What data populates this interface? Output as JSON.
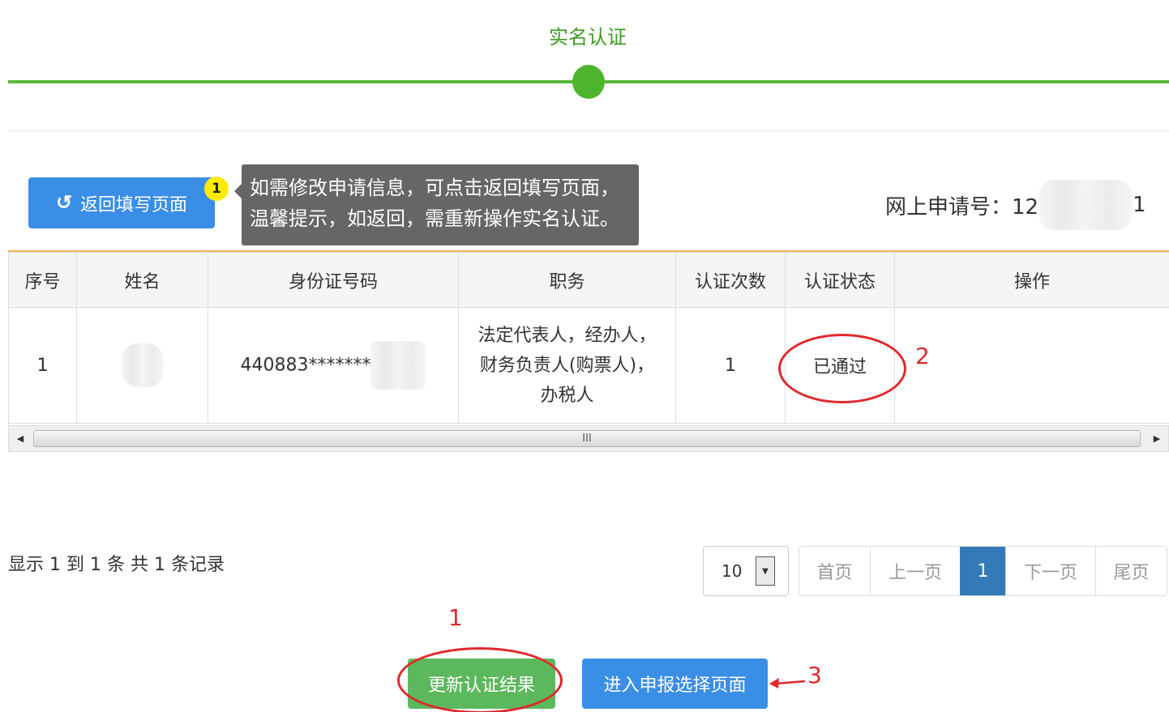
{
  "step": {
    "title": "实名认证"
  },
  "toolbar": {
    "back_label": "返回填写页面",
    "back_icon": "refresh-icon",
    "badge_number": "1"
  },
  "tooltip": {
    "line1": "如需修改申请信息，可点击返回填写页面，",
    "line2": "温馨提示，如返回，需重新操作实名认证。"
  },
  "application": {
    "label": "网上申请号：12",
    "suffix": "1"
  },
  "table": {
    "columns": [
      "序号",
      "姓名",
      "身份证号码",
      "职务",
      "认证次数",
      "认证状态",
      "操作"
    ],
    "rows": [
      {
        "index": "1",
        "name": "",
        "id_number": "440883*******",
        "duty_line1": "法定代表人，经办人，",
        "duty_line2": "财务负责人(购票人)，",
        "duty_line3": "办税人",
        "count": "1",
        "status": "已通过",
        "action": ""
      }
    ]
  },
  "scrollbar": {
    "thumb_grip": "III"
  },
  "pagination": {
    "record_info": "显示 1 到 1 条 共 1 条记录",
    "page_size": "10",
    "first": "首页",
    "prev": "上一页",
    "current": "1",
    "next": "下一页",
    "last": "尾页"
  },
  "actions": {
    "refresh_label": "更新认证结果",
    "enter_label": "进入申报选择页面"
  },
  "annotations": {
    "status_mark": "2",
    "refresh_mark": "1",
    "enter_mark": "3"
  },
  "colors": {
    "accent_green": "#5cb85c",
    "primary_blue": "#3a8ee6",
    "annotation_red": "#e0282c",
    "step_green": "#4cb52c"
  }
}
